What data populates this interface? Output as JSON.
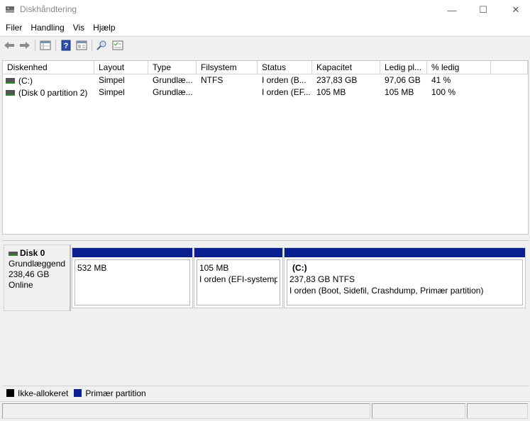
{
  "window": {
    "title": "Diskhåndtering",
    "controls": {
      "minimize": "—",
      "maximize": "☐",
      "close": "✕"
    }
  },
  "menu": [
    "Filer",
    "Handling",
    "Vis",
    "Hjælp"
  ],
  "toolbar": {
    "icons": [
      "back-arrow-icon",
      "forward-arrow-icon",
      "volume-list-icon",
      "help-icon",
      "properties-icon",
      "connect-icon",
      "settings-list-icon"
    ]
  },
  "volume_list": {
    "columns": [
      "Diskenhed",
      "Layout",
      "Type",
      "Filsystem",
      "Status",
      "Kapacitet",
      "Ledig pl...",
      "% ledig",
      ""
    ],
    "rows": [
      [
        "(C:)",
        "Simpel",
        "Grundlæ...",
        "NTFS",
        "I orden (B...",
        "237,83 GB",
        "97,06 GB",
        "41 %"
      ],
      [
        "(Disk 0 partition 2)",
        "Simpel",
        "Grundlæ...",
        "",
        "I orden (EF...",
        "105 MB",
        "105 MB",
        "100 %"
      ]
    ]
  },
  "disk": {
    "name": "Disk 0",
    "type": "Grundlæggend",
    "size": "238,46 GB",
    "status": "Online",
    "partitions": [
      {
        "label": "",
        "size": "532 MB",
        "detail": ""
      },
      {
        "label": "",
        "size": "105 MB",
        "detail": "I orden (EFI-systempa"
      },
      {
        "label": "(C:)",
        "size": "237,83 GB NTFS",
        "detail": "I orden (Boot, Sidefil, Crashdump, Primær partition)"
      }
    ]
  },
  "legend": [
    {
      "label": "Ikke-allokeret",
      "color": "#000000"
    },
    {
      "label": "Primær partition",
      "color": "#0a1f8f"
    }
  ],
  "colors": {
    "primary_partition": "#0a1f8f",
    "unallocated": "#000000"
  }
}
